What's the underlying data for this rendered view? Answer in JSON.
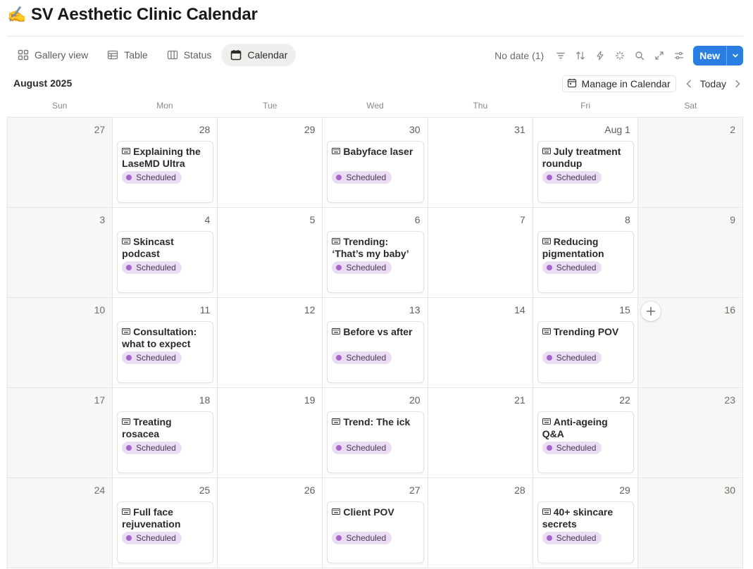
{
  "page": {
    "title_emoji": "✍️",
    "title": "SV Aesthetic Clinic Calendar"
  },
  "views": [
    {
      "label": "Gallery view",
      "icon": "gallery-icon"
    },
    {
      "label": "Table",
      "icon": "table-icon"
    },
    {
      "label": "Status",
      "icon": "board-icon"
    },
    {
      "label": "Calendar",
      "icon": "calendar-icon",
      "active": true
    }
  ],
  "toolbar": {
    "no_date": "No date (1)",
    "new_label": "New",
    "icons": [
      "filter-icon",
      "sort-icon",
      "automation-icon",
      "ai-icon",
      "search-icon",
      "expand-icon",
      "settings-icon"
    ]
  },
  "calendar": {
    "month_label": "August 2025",
    "manage_label": "Manage in Calendar",
    "today_label": "Today",
    "weekdays": [
      "Sun",
      "Mon",
      "Tue",
      "Wed",
      "Thu",
      "Fri",
      "Sat"
    ],
    "status_color": "#a565cc",
    "days": [
      {
        "n": "27",
        "weekend": true
      },
      {
        "n": "28",
        "event": {
          "title": "Explaining the LaseMD Ultra",
          "status": "Scheduled"
        }
      },
      {
        "n": "29"
      },
      {
        "n": "30",
        "event": {
          "title": "Babyface laser",
          "status": "Scheduled"
        }
      },
      {
        "n": "31"
      },
      {
        "n": "Aug 1",
        "event": {
          "title": "July treatment roundup",
          "status": "Scheduled"
        }
      },
      {
        "n": "2",
        "weekend": true
      },
      {
        "n": "3",
        "weekend": true
      },
      {
        "n": "4",
        "event": {
          "title": "Skincast podcast",
          "status": "Scheduled"
        }
      },
      {
        "n": "5"
      },
      {
        "n": "6",
        "event": {
          "title": "Trending: ‘That’s my baby’",
          "status": "Scheduled"
        }
      },
      {
        "n": "7"
      },
      {
        "n": "8",
        "event": {
          "title": "Reducing pigmentation",
          "status": "Scheduled"
        }
      },
      {
        "n": "9",
        "weekend": true
      },
      {
        "n": "10",
        "weekend": true
      },
      {
        "n": "11",
        "event": {
          "title": "Consultation: what to expect",
          "status": "Scheduled"
        }
      },
      {
        "n": "12"
      },
      {
        "n": "13",
        "event": {
          "title": "Before vs after",
          "status": "Scheduled"
        }
      },
      {
        "n": "14"
      },
      {
        "n": "15",
        "event": {
          "title": "Trending POV",
          "status": "Scheduled"
        }
      },
      {
        "n": "16",
        "weekend": true,
        "add": true
      },
      {
        "n": "17",
        "weekend": true
      },
      {
        "n": "18",
        "event": {
          "title": "Treating rosacea",
          "status": "Scheduled"
        }
      },
      {
        "n": "19"
      },
      {
        "n": "20",
        "event": {
          "title": "Trend: The ick",
          "status": "Scheduled"
        }
      },
      {
        "n": "21"
      },
      {
        "n": "22",
        "event": {
          "title": "Anti-ageing Q&A",
          "status": "Scheduled"
        }
      },
      {
        "n": "23",
        "weekend": true
      },
      {
        "n": "24",
        "weekend": true
      },
      {
        "n": "25",
        "event": {
          "title": "Full face rejuvenation",
          "status": "Scheduled"
        }
      },
      {
        "n": "26"
      },
      {
        "n": "27",
        "event": {
          "title": "Client POV",
          "status": "Scheduled"
        }
      },
      {
        "n": "28"
      },
      {
        "n": "29",
        "event": {
          "title": "40+ skincare secrets",
          "status": "Scheduled"
        }
      },
      {
        "n": "30",
        "weekend": true
      }
    ]
  }
}
